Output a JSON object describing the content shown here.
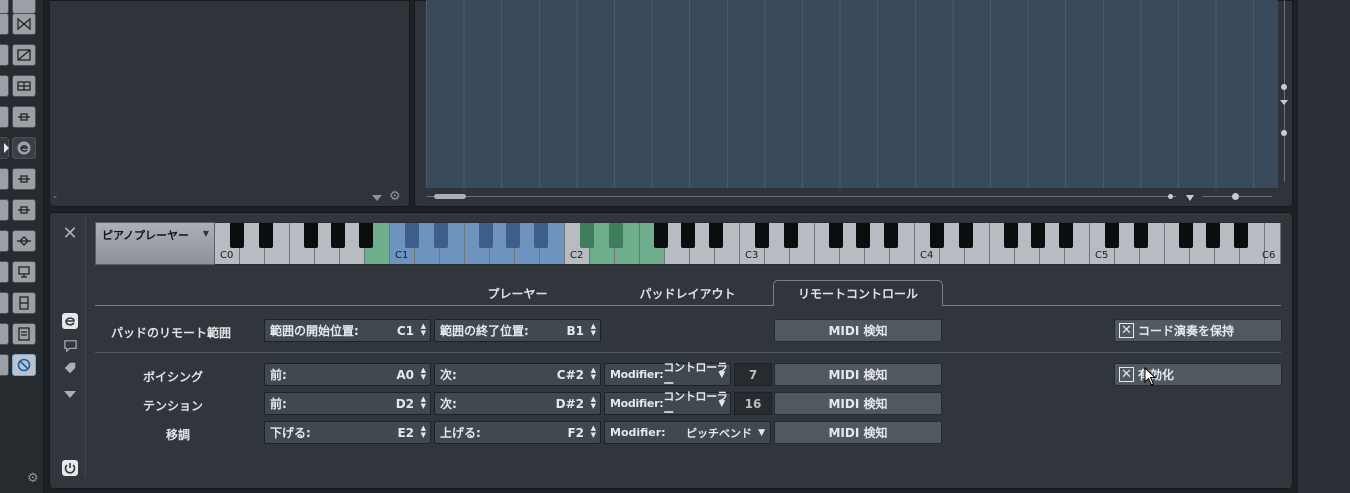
{
  "keyboard": {
    "preset": "ピアノプレーヤー",
    "octaves": [
      "C0",
      "C1",
      "C2",
      "C3",
      "C4",
      "C5",
      "C6"
    ]
  },
  "tabs": [
    {
      "label": "プレーヤー"
    },
    {
      "label": "パッドレイアウト"
    },
    {
      "label": "リモートコントロール"
    }
  ],
  "remote_range": {
    "label": "パッドのリモート範囲",
    "start_label": "範囲の開始位置:",
    "start_value": "C1",
    "end_label": "範囲の終了位置:",
    "end_value": "B1",
    "midi_button": "MIDI 検知",
    "keep_chord_label": "コード演奏を保持"
  },
  "voicing": {
    "label": "ボイシング",
    "prev_label": "前:",
    "prev_value": "A0",
    "next_label": "次:",
    "next_value": "C#2",
    "modifier_label": "Modifier:",
    "modifier_value": "コントローラー",
    "number": "7",
    "midi_button": "MIDI 検知",
    "enable_label": "有効化"
  },
  "tension": {
    "label": "テンション",
    "prev_label": "前:",
    "prev_value": "D2",
    "next_label": "次:",
    "next_value": "D#2",
    "modifier_label": "Modifier:",
    "modifier_value": "コントローラー",
    "number": "16",
    "midi_button": "MIDI 検知"
  },
  "transpose": {
    "label": "移調",
    "down_label": "下げる:",
    "down_value": "E2",
    "up_label": "上げる:",
    "up_value": "F2",
    "modifier_label": "Modifier:",
    "modifier_value": "ピッチベンド",
    "midi_button": "MIDI 検知"
  },
  "inspector": {
    "minus": "-"
  },
  "colors": {
    "green_key": "#6fae8c",
    "blue_key": "#6f93bf",
    "grid_bg": "#3a4a5d"
  }
}
